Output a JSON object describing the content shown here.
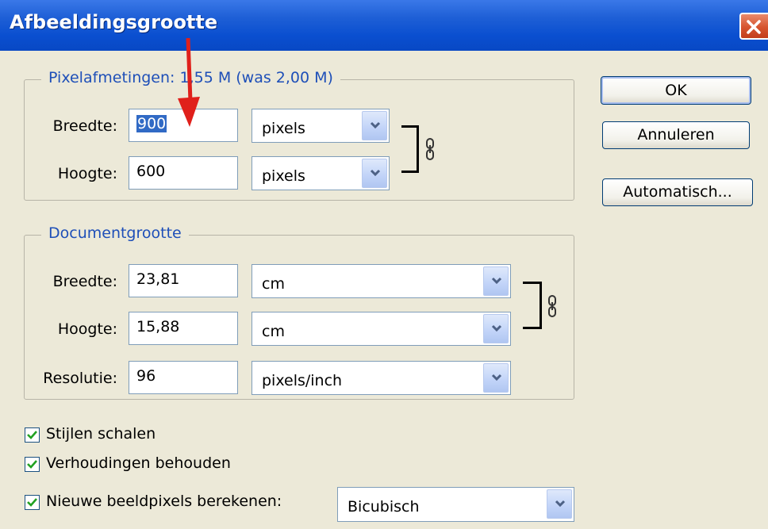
{
  "window": {
    "title": "Afbeeldingsgrootte"
  },
  "pixel_dimensions": {
    "legend": "Pixelafmetingen: 1,55 M (was 2,00 M)",
    "width": {
      "label": "Breedte:",
      "value": "900",
      "unit": "pixels"
    },
    "height": {
      "label": "Hoogte:",
      "value": "600",
      "unit": "pixels"
    }
  },
  "document_size": {
    "legend": "Documentgrootte",
    "width": {
      "label": "Breedte:",
      "value": "23,81",
      "unit": "cm"
    },
    "height": {
      "label": "Hoogte:",
      "value": "15,88",
      "unit": "cm"
    },
    "resolution": {
      "label": "Resolutie:",
      "value": "96",
      "unit": "pixels/inch"
    }
  },
  "options": {
    "scale_styles": {
      "label": "Stijlen schalen",
      "checked": true
    },
    "constrain_proportions": {
      "label": "Verhoudingen behouden",
      "checked": true
    },
    "resample": {
      "label": "Nieuwe beeldpixels berekenen:",
      "checked": true,
      "method": "Bicubisch"
    }
  },
  "buttons": {
    "ok": "OK",
    "cancel": "Annuleren",
    "auto": "Automatisch..."
  },
  "colors": {
    "legend_blue": "#1e4fb8",
    "arrow_red": "#e0201b",
    "title_bar": "#0a4fd0"
  },
  "icons": [
    "close-icon",
    "chevron-down-icon",
    "chain-link-icon",
    "checkmark-icon",
    "red-arrow-annotation"
  ]
}
